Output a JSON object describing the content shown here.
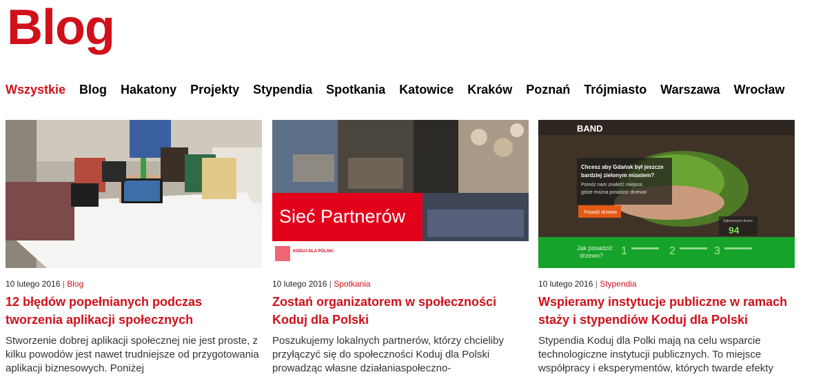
{
  "page": {
    "title": "Blog"
  },
  "nav": {
    "items": [
      {
        "label": "Wszystkie",
        "active": true
      },
      {
        "label": "Blog"
      },
      {
        "label": "Hakatony"
      },
      {
        "label": "Projekty"
      },
      {
        "label": "Stypendia"
      },
      {
        "label": "Spotkania"
      },
      {
        "label": "Katowice"
      },
      {
        "label": "Kraków"
      },
      {
        "label": "Poznań"
      },
      {
        "label": "Trójmiasto"
      },
      {
        "label": "Warszawa"
      },
      {
        "label": "Wrocław"
      }
    ]
  },
  "posts": [
    {
      "date": "10 lutego 2016",
      "separator": "|",
      "category": "Blog",
      "title": "12 błędów popełnianych podczas tworzenia aplikacji społecznych",
      "excerpt": "Stworzenie dobrej aplikacji społecznej nie jest proste, z kilku powodów jest nawet trudniejsze od przygotowania aplikacji biznesowych. Poniżej"
    },
    {
      "date": "10 lutego 2016",
      "separator": "|",
      "category": "Spotkania",
      "title": "Zostań organizatorem w społeczności Koduj dla Polski",
      "excerpt": "Poszukujemy lokalnych partnerów, którzy chcieliby przyłączyć się do społeczności Koduj dla Polski prowadząc własne działaniaspołeczno-",
      "image_text": {
        "banner": "Sieć Partnerów",
        "logo": "KODUJ DLA POLSKI"
      }
    },
    {
      "date": "10 lutego 2016",
      "separator": "|",
      "category": "Stypendia",
      "title": "Wspieramy instytucje publiczne w ramach staży i stypendiów Koduj dla Polski",
      "excerpt": "Stypendia Koduj dla Polki mają na celu wsparcie technologiczne instytucji publicznych. To miejsce współpracy i eksperymentów, których twarde efekty",
      "image_text": {
        "brand": "BAND",
        "headline_1": "Chcesz aby Gdańsk był jeszcze",
        "headline_2": "bardziej zielonym miastem?",
        "sub_1": "Pomóż nam znaleźć miejsce,",
        "sub_2": "gdzie można posadzić drzewa!",
        "cta": "Posadź drzewo",
        "counter_label": "Zgłoszonych drzew",
        "counter": "94",
        "question_1": "Jak posadzić",
        "question_2": "drzewo?",
        "steps": [
          "1",
          "2",
          "3"
        ]
      }
    }
  ],
  "colors": {
    "accent": "#d0101a",
    "text": "#000000",
    "green": "#16a32a"
  }
}
